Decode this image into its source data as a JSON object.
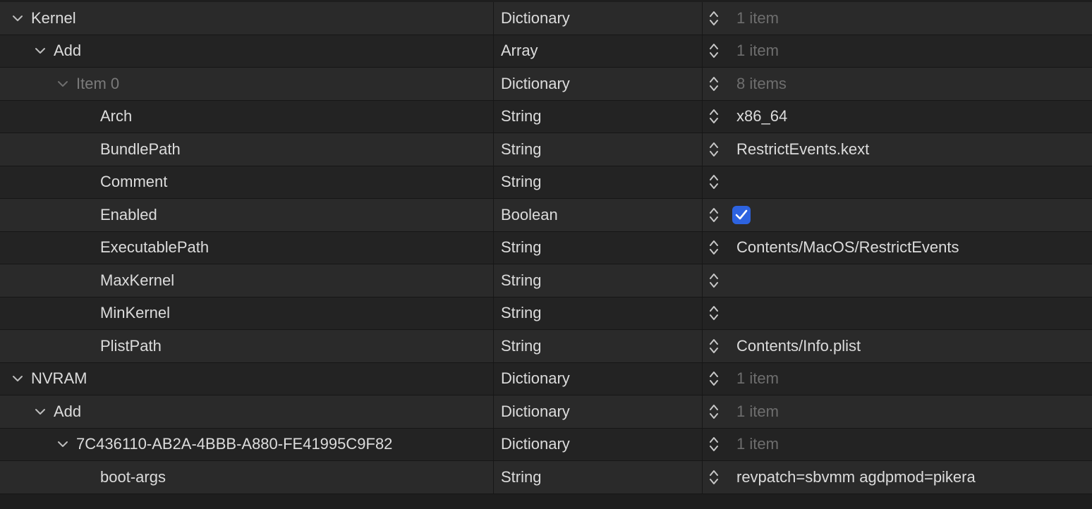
{
  "rows": [
    {
      "key": "Kernel",
      "type": "Dictionary",
      "value": "1 item",
      "expanded": true,
      "level": 0,
      "value_dim": true
    },
    {
      "key": "Add",
      "type": "Array",
      "value": "1 item",
      "expanded": true,
      "level": 1,
      "value_dim": true
    },
    {
      "key": "Item 0",
      "type": "Dictionary",
      "value": "8 items",
      "expanded": true,
      "level": 2,
      "value_dim": true,
      "key_dim": true
    },
    {
      "key": "Arch",
      "type": "String",
      "value": "x86_64",
      "level": 3
    },
    {
      "key": "BundlePath",
      "type": "String",
      "value": "RestrictEvents.kext",
      "level": 3
    },
    {
      "key": "Comment",
      "type": "String",
      "value": "",
      "level": 3
    },
    {
      "key": "Enabled",
      "type": "Boolean",
      "value": "",
      "level": 3,
      "checked": true
    },
    {
      "key": "ExecutablePath",
      "type": "String",
      "value": "Contents/MacOS/RestrictEvents",
      "level": 3
    },
    {
      "key": "MaxKernel",
      "type": "String",
      "value": "",
      "level": 3
    },
    {
      "key": "MinKernel",
      "type": "String",
      "value": "",
      "level": 3
    },
    {
      "key": "PlistPath",
      "type": "String",
      "value": "Contents/Info.plist",
      "level": 3
    },
    {
      "key": "NVRAM",
      "type": "Dictionary",
      "value": "1 item",
      "expanded": true,
      "level": 0,
      "value_dim": true
    },
    {
      "key": "Add",
      "type": "Dictionary",
      "value": "1 item",
      "expanded": true,
      "level": 1,
      "value_dim": true
    },
    {
      "key": "7C436110-AB2A-4BBB-A880-FE41995C9F82",
      "type": "Dictionary",
      "value": "1 item",
      "expanded": true,
      "level": 2,
      "value_dim": true
    },
    {
      "key": "boot-args",
      "type": "String",
      "value": "revpatch=sbvmm agdpmod=pikera",
      "level": 3
    }
  ],
  "colors": {
    "checkbox_accent": "#2d63e0",
    "row_odd": "#2a2a2a",
    "row_even": "#232323",
    "dim_text": "#6e6e6e"
  },
  "icons": {
    "disclosure": "chevron-down-icon",
    "stepper": "up-down-stepper-icon",
    "check": "checkmark-icon"
  }
}
